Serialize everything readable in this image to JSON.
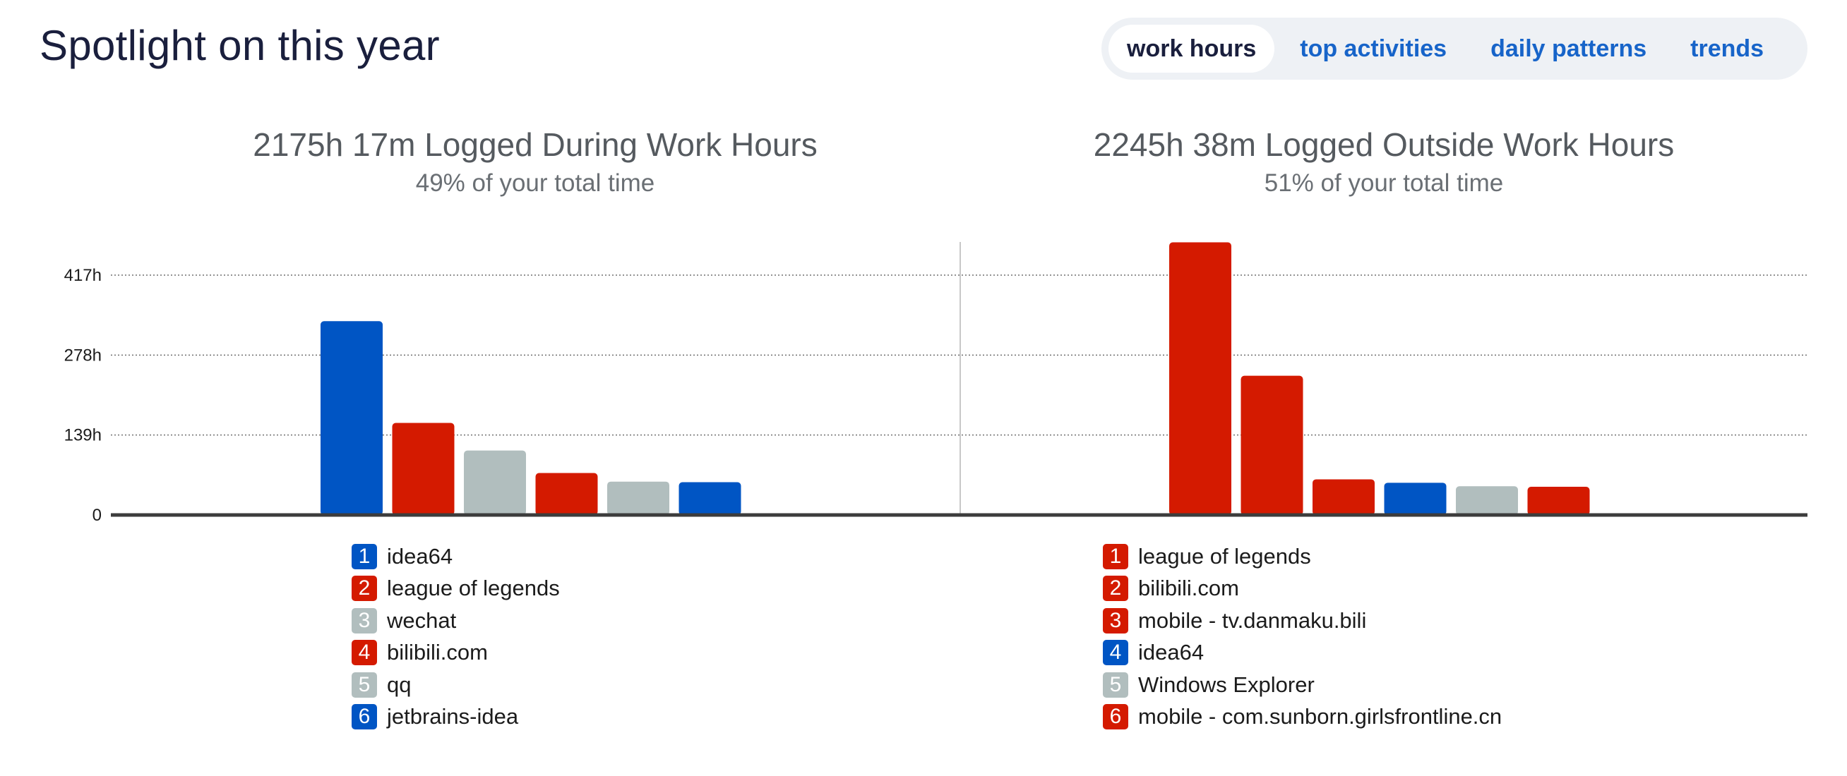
{
  "page_title": "Spotlight on this year",
  "tabs": [
    {
      "label": "work hours",
      "active": true
    },
    {
      "label": "top activities",
      "active": false
    },
    {
      "label": "daily patterns",
      "active": false
    },
    {
      "label": "trends",
      "active": false
    }
  ],
  "colors": {
    "blue": "#0055c4",
    "red": "#d41a00",
    "gray": "#b1bebe"
  },
  "panels": [
    {
      "heading": "2175h 17m Logged During Work Hours",
      "subheading": "49% of your total time"
    },
    {
      "heading": "2245h 38m Logged Outside Work Hours",
      "subheading": "51% of your total time"
    }
  ],
  "chart_data": [
    {
      "type": "bar",
      "title": "2175h 17m Logged During Work Hours",
      "subtitle": "49% of your total time",
      "categories": [
        "idea64",
        "league of legends",
        "wechat",
        "bilibili.com",
        "qq",
        "jetbrains-idea"
      ],
      "ranks": [
        "1",
        "2",
        "3",
        "4",
        "5",
        "6"
      ],
      "values": [
        337,
        160,
        112,
        73,
        58,
        57
      ],
      "bar_colors": [
        "blue",
        "red",
        "gray",
        "red",
        "gray",
        "blue"
      ],
      "y_ticks": [
        0,
        139,
        278,
        417
      ],
      "y_tick_labels": [
        "0",
        "139h",
        "278h",
        "417h"
      ],
      "ylim": [
        0,
        480
      ],
      "grid": true,
      "legend_position": "bottom"
    },
    {
      "type": "bar",
      "title": "2245h 38m Logged Outside Work Hours",
      "subtitle": "51% of your total time",
      "categories": [
        "league of legends",
        "bilibili.com",
        "mobile - tv.danmaku.bili",
        "idea64",
        "Windows Explorer",
        "mobile - com.sunborn.girlsfrontline.cn"
      ],
      "ranks": [
        "1",
        "2",
        "3",
        "4",
        "5",
        "6"
      ],
      "values": [
        474,
        242,
        62,
        56,
        50,
        49
      ],
      "bar_colors": [
        "red",
        "red",
        "red",
        "blue",
        "gray",
        "red"
      ],
      "y_ticks": [
        0,
        139,
        278,
        417
      ],
      "y_tick_labels": [
        "0",
        "139h",
        "278h",
        "417h"
      ],
      "ylim": [
        0,
        480
      ],
      "grid": true,
      "legend_position": "bottom"
    }
  ]
}
